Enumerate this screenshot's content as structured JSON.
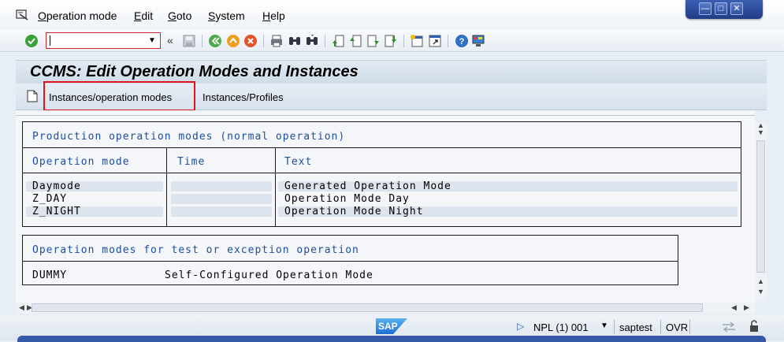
{
  "menubar": {
    "items": [
      {
        "label": "Operation mode",
        "accel": "O",
        "rest": "peration mode"
      },
      {
        "label": "Edit",
        "accel": "E",
        "rest": "dit"
      },
      {
        "label": "Goto",
        "accel": "G",
        "rest": "oto"
      },
      {
        "label": "System",
        "accel": "S",
        "rest": "ystem"
      },
      {
        "label": "Help",
        "accel": "H",
        "rest": "elp"
      }
    ],
    "window_controls": [
      "minimize",
      "maximize",
      "close"
    ]
  },
  "toolbar": {
    "command_field_value": "",
    "icons": [
      "enter-icon",
      "save-icon",
      "back-icon",
      "exit-icon",
      "cancel-icon",
      "print-icon",
      "find-icon",
      "find-next-icon",
      "first-page-icon",
      "previous-page-icon",
      "next-page-icon",
      "last-page-icon",
      "create-session-icon",
      "shortcut-icon",
      "help-icon",
      "customize-layout-icon"
    ],
    "accent": "#d12a2a"
  },
  "page": {
    "title": "CCMS: Edit Operation Modes and Instances",
    "tabs": {
      "instances_op_modes": "Instances/operation modes",
      "instances_profiles": "Instances/Profiles"
    }
  },
  "production": {
    "heading": "Production operation modes (normal operation)",
    "columns": {
      "mode": "Operation mode",
      "time": "Time",
      "text": "Text"
    },
    "rows": [
      {
        "mode": "Daymode",
        "time": "",
        "text": "Generated Operation Mode"
      },
      {
        "mode": "Z_DAY",
        "time": "",
        "text": "Operation Mode Day"
      },
      {
        "mode": "Z_NIGHT",
        "time": "",
        "text": "Operation Mode Night"
      }
    ]
  },
  "test": {
    "heading": "Operation modes for test or exception operation",
    "rows": [
      {
        "mode": "DUMMY",
        "text": "Self-Configured Operation Mode"
      }
    ]
  },
  "status": {
    "logo": "SAP",
    "system": "NPL (1) 001",
    "server": "saptest",
    "mode": "OVR"
  }
}
